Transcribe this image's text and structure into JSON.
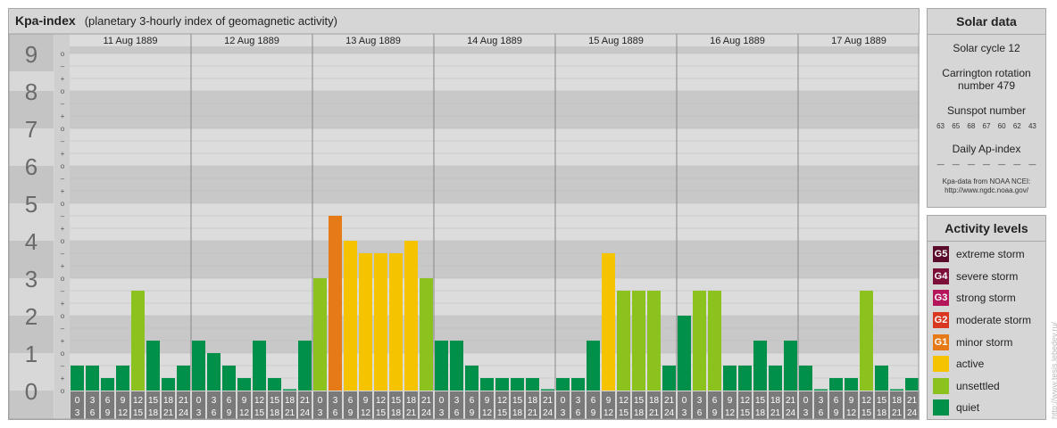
{
  "title": {
    "main": "Kpa-index",
    "sub": "(planetary 3-hourly index of geomagnetic activity)"
  },
  "chart_data": {
    "type": "bar",
    "title": "Kpa-index",
    "subtitle": "(planetary 3-hourly index of geomagnetic activity)",
    "y_ticks": [
      "0",
      "1",
      "2",
      "3",
      "4",
      "5",
      "6",
      "7",
      "8",
      "9"
    ],
    "y_minor_ticks": [
      "o",
      "+",
      "-"
    ],
    "ylim": [
      0,
      9.33
    ],
    "grid": true,
    "days": [
      "11 Aug 1889",
      "12 Aug 1889",
      "13 Aug 1889",
      "14 Aug 1889",
      "15 Aug 1889",
      "16 Aug 1889",
      "17 Aug 1889"
    ],
    "interval_labels": [
      [
        "0",
        "3"
      ],
      [
        "3",
        "6"
      ],
      [
        "6",
        "9"
      ],
      [
        "9",
        "12"
      ],
      [
        "12",
        "15"
      ],
      [
        "15",
        "18"
      ],
      [
        "18",
        "21"
      ],
      [
        "21",
        "24"
      ]
    ],
    "values": [
      [
        0.667,
        0.667,
        0.333,
        0.667,
        2.667,
        1.333,
        0.333,
        0.667
      ],
      [
        1.333,
        1.0,
        0.667,
        0.333,
        1.333,
        0.333,
        0,
        1.333
      ],
      [
        3.0,
        4.667,
        4.0,
        3.667,
        3.667,
        3.667,
        4.0,
        3.0
      ],
      [
        1.333,
        1.333,
        0.667,
        0.333,
        0.333,
        0.333,
        0.333,
        0
      ],
      [
        0.333,
        0.333,
        1.333,
        3.667,
        2.667,
        2.667,
        2.667,
        0.667
      ],
      [
        2.0,
        2.667,
        2.667,
        0.667,
        0.667,
        1.333,
        0.667,
        1.333
      ],
      [
        0.667,
        0,
        0.333,
        0.333,
        2.667,
        0.667,
        0,
        0.333
      ]
    ],
    "colors": {
      "quiet": "#00904a",
      "unsettled": "#8cc21e",
      "active": "#f6c300",
      "minor_storm": "#e57a17"
    }
  },
  "solar": {
    "title": "Solar data",
    "cycle": "Solar cycle 12",
    "carrington_1": "Carrington rotation",
    "carrington_2": "number 479",
    "sunspot_label": "Sunspot number",
    "sunspots": [
      "63",
      "65",
      "68",
      "67",
      "60",
      "62",
      "43"
    ],
    "ap_label": "Daily Ap-index",
    "ap_values": [
      "—",
      "—",
      "—",
      "—",
      "—",
      "—",
      "—"
    ],
    "credit_1": "Kpa-data from NOAA NCEI:",
    "credit_2": "http://www.ngdc.noaa.gov/"
  },
  "activity": {
    "title": "Activity levels",
    "items": [
      {
        "code": "G5",
        "label": "extreme storm",
        "color": "#5a0a2a"
      },
      {
        "code": "G4",
        "label": "severe storm",
        "color": "#7b0f3a"
      },
      {
        "code": "G3",
        "label": "strong storm",
        "color": "#b5155a"
      },
      {
        "code": "G2",
        "label": "moderate storm",
        "color": "#d9371f"
      },
      {
        "code": "G1",
        "label": "minor storm",
        "color": "#e57a17"
      },
      {
        "code": "",
        "label": "active",
        "color": "#f6c300"
      },
      {
        "code": "",
        "label": "unsettled",
        "color": "#8cc21e"
      },
      {
        "code": "",
        "label": "quiet",
        "color": "#00904a"
      }
    ]
  },
  "watermark": "http://www.tesis.lebedev.ru/"
}
